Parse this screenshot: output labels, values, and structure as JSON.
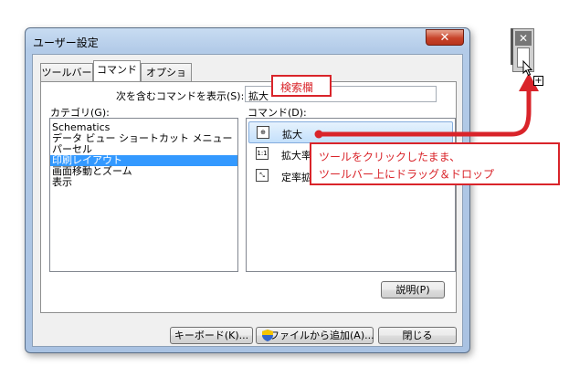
{
  "window": {
    "title": "ユーザー設定",
    "close_glyph": "✕"
  },
  "tabs": [
    {
      "label": "ツールバー",
      "active": false
    },
    {
      "label": "コマンド",
      "active": true
    },
    {
      "label": "オプション",
      "active": false
    }
  ],
  "search": {
    "label": "次を含むコマンドを表示(S):",
    "value": "拡大"
  },
  "categories": {
    "label": "カテゴリ(G):",
    "items": [
      "Schematics",
      "データ ビュー ショートカット メニュー",
      "パーセル",
      "印刷レイアウト",
      "画面移動とズーム",
      "表示"
    ],
    "selected_index": 3
  },
  "commands": {
    "label": "コマンド(D):",
    "items": [
      {
        "label": "拡大",
        "icon": "zoom-in-icon",
        "selected": true
      },
      {
        "label": "拡大率",
        "icon": "zoom-ratio-icon",
        "selected": false
      },
      {
        "label": "定率拡大",
        "icon": "fixed-zoom-in-icon",
        "selected": false
      }
    ]
  },
  "buttons": {
    "describe": "説明(P)",
    "keyboard": "キーボード(K)...",
    "add_from_file": "ファイルから追加(A)...",
    "close": "閉じる"
  },
  "annotations": {
    "search_callout": "検索欄",
    "drag_callout_line1": "ツールをクリックしたまま、",
    "drag_callout_line2": "ツールバー上にドラッグ＆ドロップ"
  },
  "mini_toolbar": {
    "close_glyph": "✕",
    "plus_glyph": "+"
  },
  "colors": {
    "annotation_red": "#d9242a",
    "selection_blue": "#3399ff",
    "close_red": "#c7432a"
  }
}
